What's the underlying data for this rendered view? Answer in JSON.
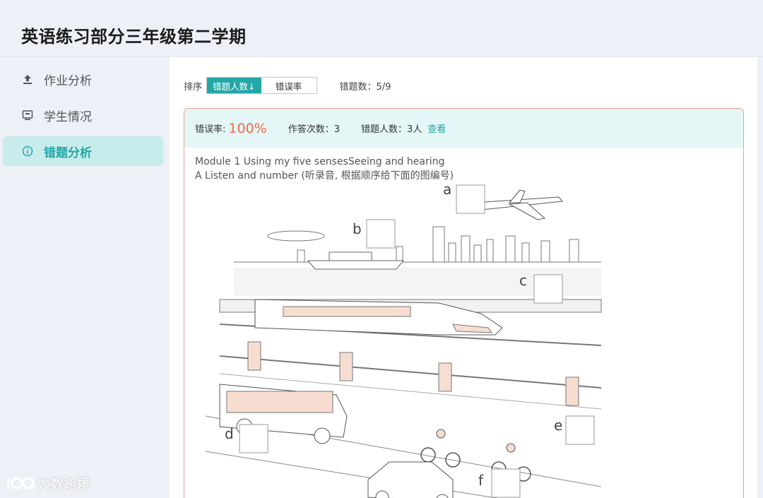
{
  "header": {
    "title": "英语练习部分三年级第二学期"
  },
  "sidebar": {
    "items": [
      {
        "label": "作业分析",
        "icon": "upload-icon",
        "active": false
      },
      {
        "label": "学生情况",
        "icon": "monitor-icon",
        "active": false
      },
      {
        "label": "错题分析",
        "icon": "info-icon",
        "active": true
      }
    ]
  },
  "sortbar": {
    "label": "排序",
    "options": [
      "错题人数↓",
      "错误率"
    ],
    "selected": "错题人数↓",
    "count_text": "错题数：5/9"
  },
  "question": {
    "error_rate_label": "错误率:",
    "error_rate_value": "100%",
    "attempts_text": "作答次数：3",
    "wrong_people_text": "错题人数：3人",
    "view_link": "查看",
    "text_line1": "Module 1 Using my five sensesSeeing and hearing",
    "text_line2": "A Listen and number (听录音, 根据顺序给下面的图编号)",
    "image_labels": [
      "a",
      "b",
      "c",
      "d",
      "e",
      "f"
    ]
  },
  "watermark": {
    "text": "大数跨境"
  },
  "colors": {
    "accent": "#23a7a7",
    "error": "#ef6b4c",
    "card_border": "#e9a18f",
    "card_head_bg": "#e4f6f6"
  }
}
